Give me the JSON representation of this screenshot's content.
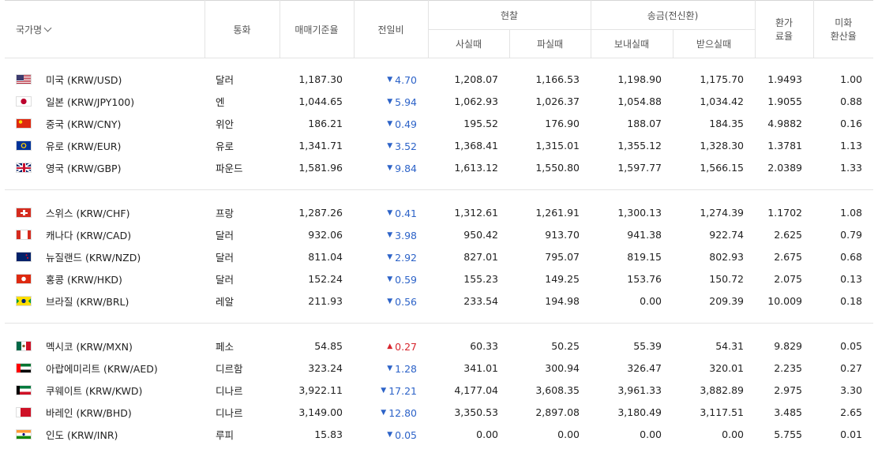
{
  "header": {
    "country": "국가명",
    "currency": "통화",
    "base_rate": "매매기준율",
    "change": "전일비",
    "cash": "현찰",
    "cash_buy": "사실때",
    "cash_sell": "파실때",
    "transfer": "송금(전신환)",
    "transfer_send": "보내실때",
    "transfer_receive": "받으실때",
    "exchange_ratio_1": "환가",
    "exchange_ratio_2": "료율",
    "usd_ratio_1": "미화",
    "usd_ratio_2": "환산율"
  },
  "flags": {
    "us": "us-flag-icon",
    "jp": "jp-flag-icon",
    "cn": "cn-flag-icon",
    "eu": "eu-flag-icon",
    "gb": "gb-flag-icon",
    "ch": "ch-flag-icon",
    "ca": "ca-flag-icon",
    "nz": "nz-flag-icon",
    "hk": "hk-flag-icon",
    "br": "br-flag-icon",
    "mx": "mx-flag-icon",
    "ae": "ae-flag-icon",
    "kw": "kw-flag-icon",
    "bh": "bh-flag-icon",
    "in": "in-flag-icon"
  },
  "colors": {
    "down": "#2d63c8",
    "up": "#d7262e"
  },
  "rows": [
    {
      "name": "미국 (KRW/USD)",
      "currency": "달러",
      "base": "1,187.30",
      "dir": "down",
      "change": "4.70",
      "cash_buy": "1,208.07",
      "cash_sell": "1,166.53",
      "send": "1,198.90",
      "receive": "1,175.70",
      "ratio": "1.9493",
      "usd": "1.00"
    },
    {
      "name": "일본 (KRW/JPY100)",
      "currency": "엔",
      "base": "1,044.65",
      "dir": "down",
      "change": "5.94",
      "cash_buy": "1,062.93",
      "cash_sell": "1,026.37",
      "send": "1,054.88",
      "receive": "1,034.42",
      "ratio": "1.9055",
      "usd": "0.88"
    },
    {
      "name": "중국 (KRW/CNY)",
      "currency": "위안",
      "base": "186.21",
      "dir": "down",
      "change": "0.49",
      "cash_buy": "195.52",
      "cash_sell": "176.90",
      "send": "188.07",
      "receive": "184.35",
      "ratio": "4.9882",
      "usd": "0.16"
    },
    {
      "name": "유로 (KRW/EUR)",
      "currency": "유로",
      "base": "1,341.71",
      "dir": "down",
      "change": "3.52",
      "cash_buy": "1,368.41",
      "cash_sell": "1,315.01",
      "send": "1,355.12",
      "receive": "1,328.30",
      "ratio": "1.3781",
      "usd": "1.13"
    },
    {
      "name": "영국 (KRW/GBP)",
      "currency": "파운드",
      "base": "1,581.96",
      "dir": "down",
      "change": "9.84",
      "cash_buy": "1,613.12",
      "cash_sell": "1,550.80",
      "send": "1,597.77",
      "receive": "1,566.15",
      "ratio": "2.0389",
      "usd": "1.33"
    },
    {
      "name": "스위스 (KRW/CHF)",
      "currency": "프랑",
      "base": "1,287.26",
      "dir": "down",
      "change": "0.41",
      "cash_buy": "1,312.61",
      "cash_sell": "1,261.91",
      "send": "1,300.13",
      "receive": "1,274.39",
      "ratio": "1.1702",
      "usd": "1.08"
    },
    {
      "name": "캐나다 (KRW/CAD)",
      "currency": "달러",
      "base": "932.06",
      "dir": "down",
      "change": "3.98",
      "cash_buy": "950.42",
      "cash_sell": "913.70",
      "send": "941.38",
      "receive": "922.74",
      "ratio": "2.625",
      "usd": "0.79"
    },
    {
      "name": "뉴질랜드 (KRW/NZD)",
      "currency": "달러",
      "base": "811.04",
      "dir": "down",
      "change": "2.92",
      "cash_buy": "827.01",
      "cash_sell": "795.07",
      "send": "819.15",
      "receive": "802.93",
      "ratio": "2.675",
      "usd": "0.68"
    },
    {
      "name": "홍콩 (KRW/HKD)",
      "currency": "달러",
      "base": "152.24",
      "dir": "down",
      "change": "0.59",
      "cash_buy": "155.23",
      "cash_sell": "149.25",
      "send": "153.76",
      "receive": "150.72",
      "ratio": "2.075",
      "usd": "0.13"
    },
    {
      "name": "브라질 (KRW/BRL)",
      "currency": "레알",
      "base": "211.93",
      "dir": "down",
      "change": "0.56",
      "cash_buy": "233.54",
      "cash_sell": "194.98",
      "send": "0.00",
      "receive": "209.39",
      "ratio": "10.009",
      "usd": "0.18"
    },
    {
      "name": "멕시코 (KRW/MXN)",
      "currency": "페소",
      "base": "54.85",
      "dir": "up",
      "change": "0.27",
      "cash_buy": "60.33",
      "cash_sell": "50.25",
      "send": "55.39",
      "receive": "54.31",
      "ratio": "9.829",
      "usd": "0.05"
    },
    {
      "name": "아랍에미리트 (KRW/AED)",
      "currency": "디르함",
      "base": "323.24",
      "dir": "down",
      "change": "1.28",
      "cash_buy": "341.01",
      "cash_sell": "300.94",
      "send": "326.47",
      "receive": "320.01",
      "ratio": "2.235",
      "usd": "0.27"
    },
    {
      "name": "쿠웨이트 (KRW/KWD)",
      "currency": "디나르",
      "base": "3,922.11",
      "dir": "down",
      "change": "17.21",
      "cash_buy": "4,177.04",
      "cash_sell": "3,608.35",
      "send": "3,961.33",
      "receive": "3,882.89",
      "ratio": "2.975",
      "usd": "3.30"
    },
    {
      "name": "바레인 (KRW/BHD)",
      "currency": "디나르",
      "base": "3,149.00",
      "dir": "down",
      "change": "12.80",
      "cash_buy": "3,350.53",
      "cash_sell": "2,897.08",
      "send": "3,180.49",
      "receive": "3,117.51",
      "ratio": "3.485",
      "usd": "2.65"
    },
    {
      "name": "인도 (KRW/INR)",
      "currency": "루피",
      "base": "15.83",
      "dir": "down",
      "change": "0.05",
      "cash_buy": "0.00",
      "cash_sell": "0.00",
      "send": "0.00",
      "receive": "0.00",
      "ratio": "5.755",
      "usd": "0.01"
    }
  ]
}
